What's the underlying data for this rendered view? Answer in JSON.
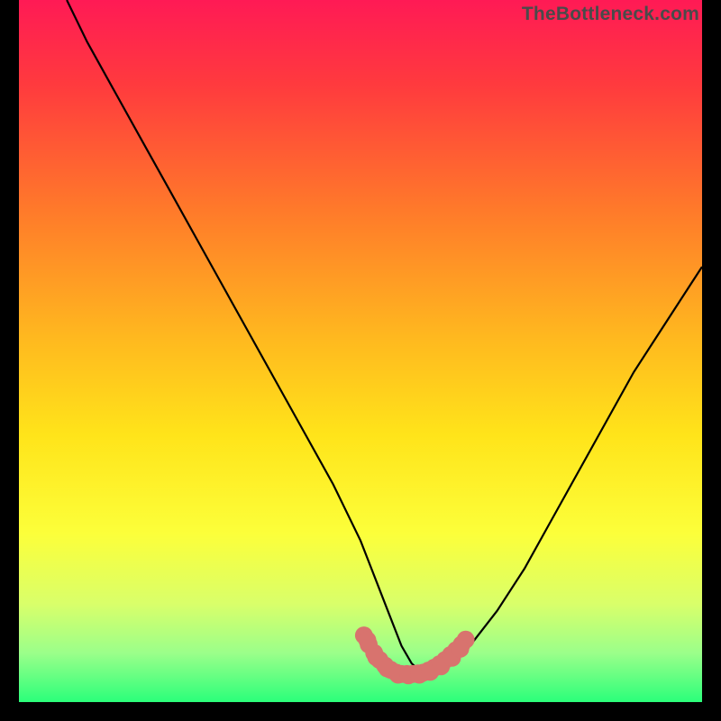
{
  "watermark": "TheBottleneck.com",
  "chart_data": {
    "type": "line",
    "title": "",
    "xlabel": "",
    "ylabel": "",
    "xlim": [
      0,
      100
    ],
    "ylim": [
      0,
      100
    ],
    "gradient_stops": [
      {
        "offset": 0,
        "color": "#ff1a55"
      },
      {
        "offset": 12,
        "color": "#ff3a3e"
      },
      {
        "offset": 30,
        "color": "#ff7a2a"
      },
      {
        "offset": 48,
        "color": "#ffb81f"
      },
      {
        "offset": 62,
        "color": "#ffe41a"
      },
      {
        "offset": 76,
        "color": "#fcff3a"
      },
      {
        "offset": 86,
        "color": "#d9ff6a"
      },
      {
        "offset": 93,
        "color": "#9bff8a"
      },
      {
        "offset": 100,
        "color": "#2bff7a"
      }
    ],
    "series": [
      {
        "name": "bottleneck-curve",
        "color": "#000000",
        "x": [
          7,
          10,
          14,
          18,
          22,
          26,
          30,
          34,
          38,
          42,
          46,
          50,
          52,
          54,
          56,
          57.5,
          59,
          61,
          63,
          66,
          70,
          74,
          78,
          82,
          86,
          90,
          94,
          98,
          100
        ],
        "y": [
          100,
          94,
          87,
          80,
          73,
          66,
          59,
          52,
          45,
          38,
          31,
          23,
          18,
          13,
          8,
          5.5,
          4.2,
          4.2,
          5.5,
          8,
          13,
          19,
          26,
          33,
          40,
          47,
          53,
          59,
          62
        ]
      }
    ],
    "marker_cluster": {
      "color": "#d8736e",
      "radius": 1.3,
      "points": [
        [
          50.5,
          9.5
        ],
        [
          51.2,
          8.2
        ],
        [
          52.0,
          7.0
        ],
        [
          52.8,
          6.0
        ],
        [
          53.6,
          5.2
        ],
        [
          54.4,
          4.6
        ],
        [
          55.2,
          4.2
        ],
        [
          56.0,
          4.0
        ],
        [
          56.8,
          4.0
        ],
        [
          57.6,
          4.0
        ],
        [
          58.4,
          4.1
        ],
        [
          59.2,
          4.2
        ],
        [
          60.0,
          4.5
        ],
        [
          60.8,
          4.9
        ],
        [
          61.6,
          5.4
        ],
        [
          62.4,
          6.0
        ],
        [
          63.2,
          6.7
        ],
        [
          64.0,
          7.4
        ],
        [
          64.8,
          8.2
        ],
        [
          65.4,
          8.9
        ],
        [
          51.0,
          8.8
        ],
        [
          52.3,
          6.4
        ],
        [
          53.9,
          4.8
        ],
        [
          55.5,
          3.9
        ],
        [
          57.0,
          3.8
        ],
        [
          58.6,
          3.9
        ],
        [
          60.2,
          4.3
        ],
        [
          61.8,
          5.1
        ],
        [
          63.4,
          6.3
        ],
        [
          64.6,
          7.6
        ]
      ]
    }
  }
}
